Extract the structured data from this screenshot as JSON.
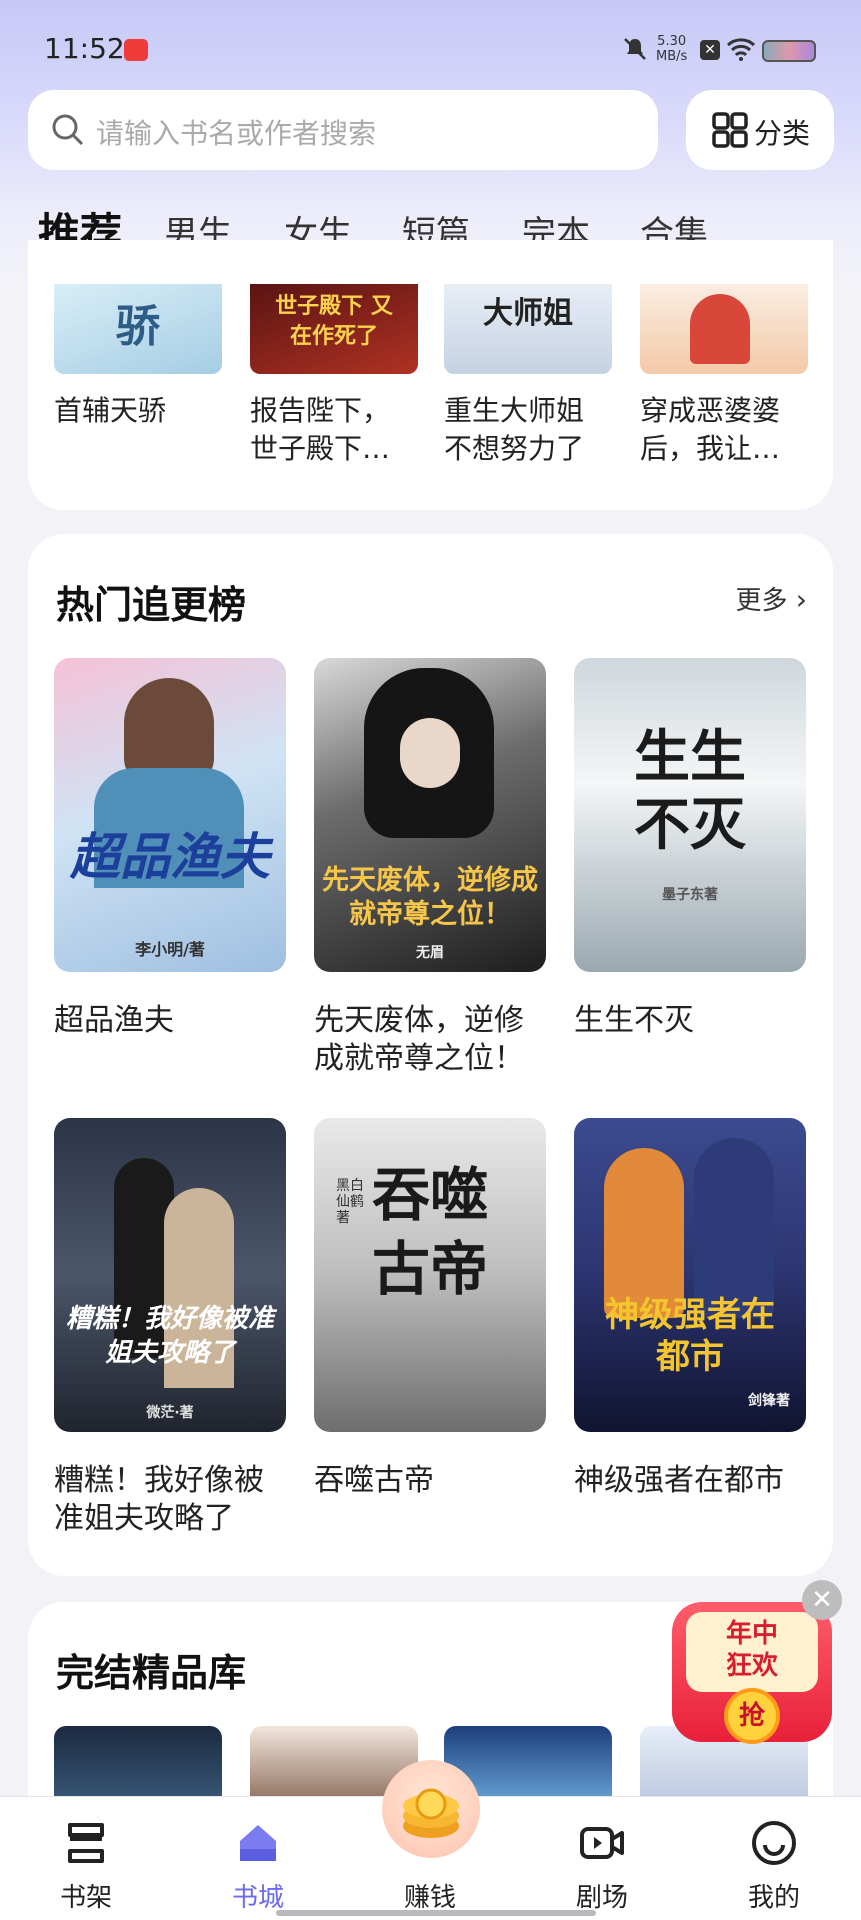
{
  "status_bar": {
    "time": "11:52",
    "net_speed_value": "5.30",
    "net_speed_unit": "MB/s"
  },
  "search": {
    "placeholder": "请输入书名或作者搜索"
  },
  "category_button": {
    "label": "分类"
  },
  "tabs": [
    {
      "label": "推荐",
      "active": true
    },
    {
      "label": "男生"
    },
    {
      "label": "女生"
    },
    {
      "label": "短篇"
    },
    {
      "label": "完本"
    },
    {
      "label": "合集"
    }
  ],
  "top_section": {
    "books": [
      {
        "title_line1": "首辅天骄",
        "title_line2": "",
        "cover_text": "骄"
      },
      {
        "title_line1": "报告陛下，",
        "title_line2": "世子殿下…",
        "cover_text": "世子殿下 又在作死了"
      },
      {
        "title_line1": "重生大师姐",
        "title_line2": "不想努力了",
        "cover_text": "大师姐"
      },
      {
        "title_line1": "穿成恶婆婆",
        "title_line2": "后，我让…",
        "cover_text": ""
      }
    ]
  },
  "hot_section": {
    "title": "热门追更榜",
    "more_label": "更多",
    "books": [
      {
        "title_line1": "超品渔夫",
        "title_line2": "",
        "cover_text": "超品渔夫",
        "cover_author": "李小明/著"
      },
      {
        "title_line1": "先天废体，逆修",
        "title_line2": "成就帝尊之位！",
        "cover_text": "先天废体，逆修成就帝尊之位！",
        "cover_author": "无眉"
      },
      {
        "title_line1": "生生不灭",
        "title_line2": "",
        "cover_text": "生生不灭",
        "cover_author": "墨子东著"
      },
      {
        "title_line1": "糟糕！我好像被",
        "title_line2": "准姐夫攻略了",
        "cover_text": "糟糕！我好像被准姐夫攻略了",
        "cover_author": "微茫·著"
      },
      {
        "title_line1": "吞噬古帝",
        "title_line2": "",
        "cover_text": "吞噬古帝",
        "cover_author": "黑白仙鹤著"
      },
      {
        "title_line1": "神级强者在都市",
        "title_line2": "",
        "cover_text": "神级强者在都市",
        "cover_author": "剑锋著"
      }
    ]
  },
  "complete_section": {
    "title": "完结精品库"
  },
  "promo": {
    "line1": "年中",
    "line2": "狂欢",
    "button": "抢"
  },
  "bottom_nav": [
    {
      "label": "书架",
      "icon": "bookshelf-icon"
    },
    {
      "label": "书城",
      "icon": "home-icon",
      "active": true
    },
    {
      "label": "赚钱",
      "icon": "coins-icon"
    },
    {
      "label": "剧场",
      "icon": "video-icon"
    },
    {
      "label": "我的",
      "icon": "smile-icon"
    }
  ],
  "colors": {
    "accent": "#6b6bef",
    "header_gradient_top": "#c7c8f6",
    "background": "#f3f3f7"
  }
}
